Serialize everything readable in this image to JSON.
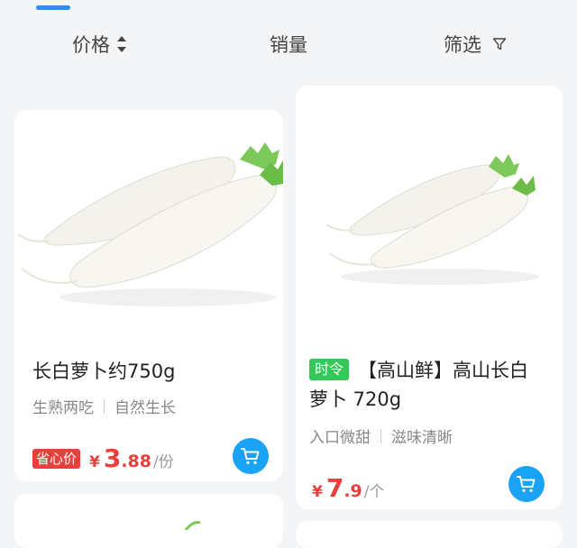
{
  "sort_bar": {
    "price_label": "价格",
    "sales_label": "销量",
    "filter_label": "筛选"
  },
  "products": [
    {
      "title": "长白萝卜约750g",
      "desc_1": "生熟两吃",
      "desc_2": "自然生长",
      "badge": "省心价",
      "currency": "¥",
      "price_int": "3",
      "price_dec": ".88",
      "unit": "/份"
    },
    {
      "tag": "时令",
      "title": "【高山鲜】高山长白萝卜 720g",
      "desc_1": "入口微甜",
      "desc_2": "滋味清晰",
      "currency": "¥",
      "price_int": "7",
      "price_dec": ".9",
      "unit": "/个"
    }
  ],
  "colors": {
    "accent_blue": "#1aa3f5",
    "price_red": "#e8403a",
    "tag_green": "#35c759"
  }
}
